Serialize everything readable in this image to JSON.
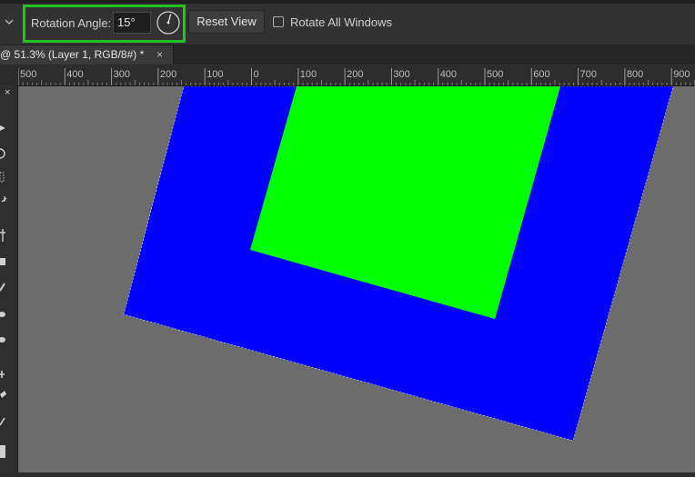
{
  "options_bar": {
    "rotation_label": "Rotation Angle:",
    "rotation_value": "15°",
    "reset_view_label": "Reset View",
    "rotate_all_windows_label": "Rotate All Windows",
    "rotate_all_windows_checked": false,
    "highlight_color": "#23c323"
  },
  "document_tab": {
    "title": "@ 51.3% (Layer 1, RGB/8#) *",
    "close_glyph": "×"
  },
  "ruler": {
    "labels": [
      "500",
      "400",
      "300",
      "200",
      "100",
      "0",
      "100",
      "200",
      "300",
      "400",
      "500",
      "600",
      "700",
      "800",
      "900"
    ]
  },
  "toolbar": {
    "close_glyph": "×",
    "tools": [
      "move-tool-icon",
      "lasso-tool-icon",
      "object-select-icon",
      "magic-wand-icon",
      "crop-tool-icon",
      "frame-tool-icon",
      "eyedropper-icon",
      "healing-brush-icon",
      "brush-tool-icon",
      "clone-stamp-icon",
      "history-brush-icon",
      "eraser-icon",
      "pen-icon",
      "rectangle-icon"
    ]
  },
  "canvas": {
    "background_color": "#6c6c6c",
    "outer_shape_color": "#0000ff",
    "inner_shape_color": "#00ff00"
  }
}
